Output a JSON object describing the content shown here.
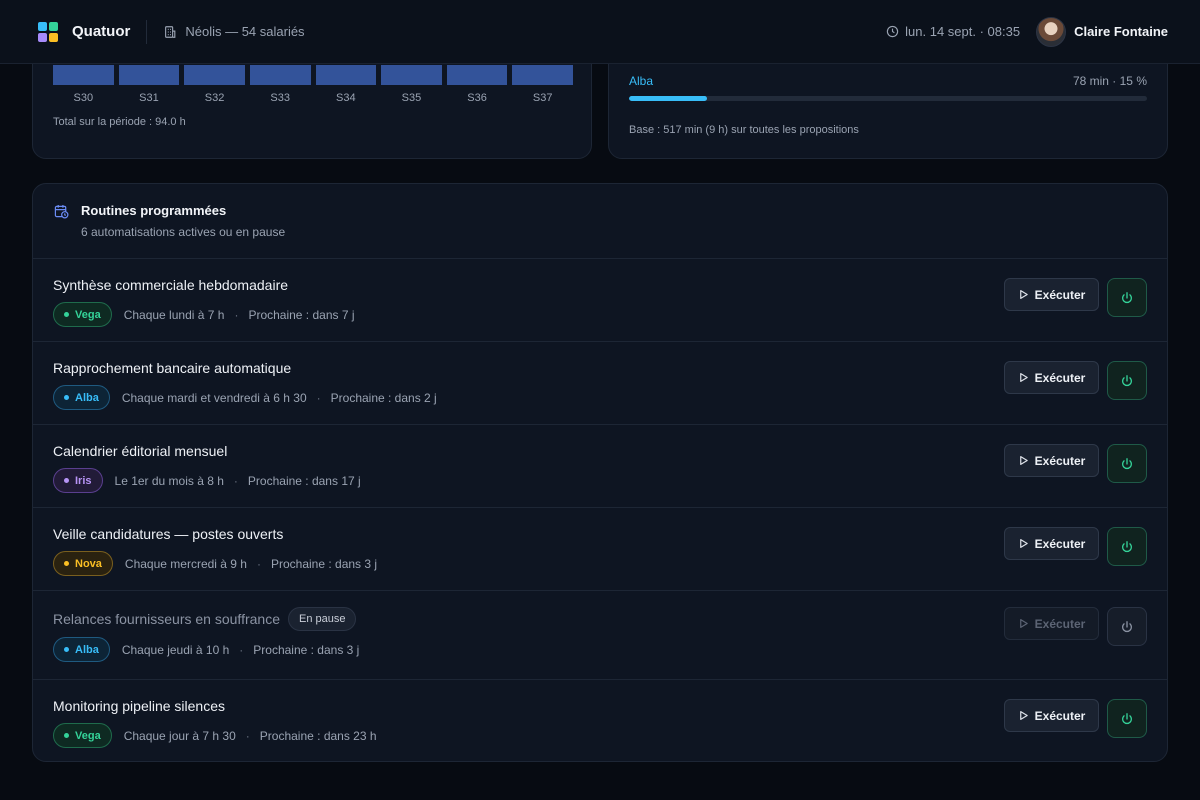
{
  "app": {
    "brand": "Quatuor",
    "org": "Néolis — 54 salariés",
    "datetime": "lun. 14 sept. · 08:35",
    "user_name": "Claire Fontaine",
    "logo_colors": [
      "#38bdf8",
      "#34d399",
      "#a78bfa",
      "#fbbf24"
    ]
  },
  "weekly_hours": {
    "weeks": [
      "S30",
      "S31",
      "S32",
      "S33",
      "S34",
      "S35",
      "S36",
      "S37"
    ],
    "total": "Total sur la période : 94.0 h"
  },
  "agent_share": {
    "name": "Alba",
    "value": "78 min · 15 %",
    "fraction": 0.15,
    "base": "Base : 517 min (9 h) sur toutes les propositions"
  },
  "routines": {
    "title": "Routines programmées",
    "subtitle": "6 automatisations actives ou en pause",
    "exec_label": "Exécuter",
    "pause_label": "En pause",
    "items": [
      {
        "title": "Synthèse commerciale hebdomadaire",
        "agent": "Vega",
        "agent_class": "vega",
        "schedule": "Chaque lundi à 7 h",
        "next": "Prochaine : dans 7 j",
        "paused": false
      },
      {
        "title": "Rapprochement bancaire automatique",
        "agent": "Alba",
        "agent_class": "alba",
        "schedule": "Chaque mardi et vendredi à 6 h 30",
        "next": "Prochaine : dans 2 j",
        "paused": false
      },
      {
        "title": "Calendrier éditorial mensuel",
        "agent": "Iris",
        "agent_class": "iris",
        "schedule": "Le 1er du mois à 8 h",
        "next": "Prochaine : dans 17 j",
        "paused": false
      },
      {
        "title": "Veille candidatures — postes ouverts",
        "agent": "Nova",
        "agent_class": "nova",
        "schedule": "Chaque mercredi à 9 h",
        "next": "Prochaine : dans 3 j",
        "paused": false
      },
      {
        "title": "Relances fournisseurs en souffrance",
        "agent": "Alba",
        "agent_class": "alba",
        "schedule": "Chaque jeudi à 10 h",
        "next": "Prochaine : dans 3 j",
        "paused": true
      },
      {
        "title": "Monitoring pipeline silences",
        "agent": "Vega",
        "agent_class": "vega",
        "schedule": "Chaque jour à 7 h 30",
        "next": "Prochaine : dans 23 h",
        "paused": false
      }
    ]
  }
}
